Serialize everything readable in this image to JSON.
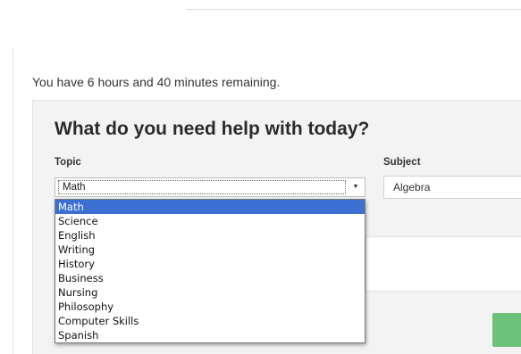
{
  "status": {
    "remaining_text": "You have 6 hours and 40 minutes remaining."
  },
  "form": {
    "title": "What do you need help with today?",
    "topic_label": "Topic",
    "subject_label": "Subject",
    "topic_value": "Math",
    "subject_value": "Algebra",
    "topic_options": [
      "Math",
      "Science",
      "English",
      "Writing",
      "History",
      "Business",
      "Nursing",
      "Philosophy",
      "Computer Skills",
      "Spanish"
    ],
    "selected_option": "Math"
  },
  "colors": {
    "accent_green": "#6cc27a",
    "selection_blue": "#3b6fd1",
    "panel_bg": "#f3f3f3"
  },
  "icons": {
    "topic_dropdown": "caret-down-icon"
  }
}
